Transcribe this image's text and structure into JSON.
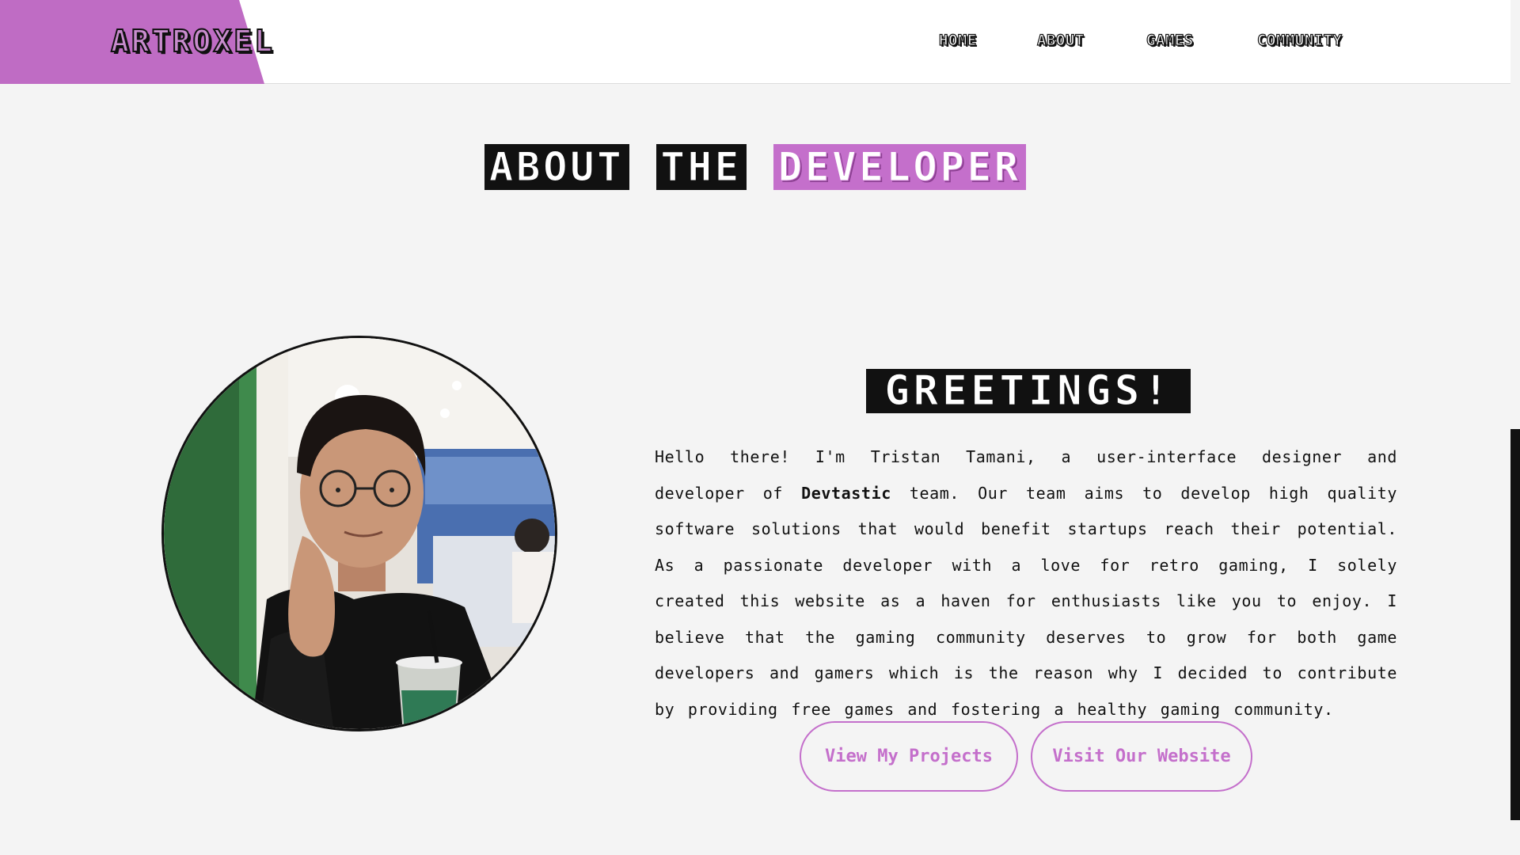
{
  "brand": {
    "logo": "ARTROXEL",
    "accent_color": "#c46fcb"
  },
  "nav": {
    "items": [
      {
        "label": "HOME"
      },
      {
        "label": "ABOUT"
      },
      {
        "label": "GAMES"
      },
      {
        "label": "COMMUNITY"
      }
    ]
  },
  "title": {
    "part1": "ABOUT",
    "part2": "THE",
    "part3": "DEVELOPER"
  },
  "greeting": {
    "heading": "GREETINGS!",
    "bio_pre": "Hello there! I'm Tristan Tamani, a user-interface designer and developer of ",
    "bio_team": "Devtastic",
    "bio_post": " team. Our team aims to develop high quality software solutions that would benefit startups reach their potential. As a passionate developer with a love for retro gaming, I solely created this website as a haven for enthusiasts like you to enjoy. I believe that the gaming community deserves to grow for both game developers and gamers which is the reason why I decided to contribute by providing free games and fostering a healthy gaming community."
  },
  "buttons": {
    "projects": "View My Projects",
    "website": "Visit Our Website"
  }
}
